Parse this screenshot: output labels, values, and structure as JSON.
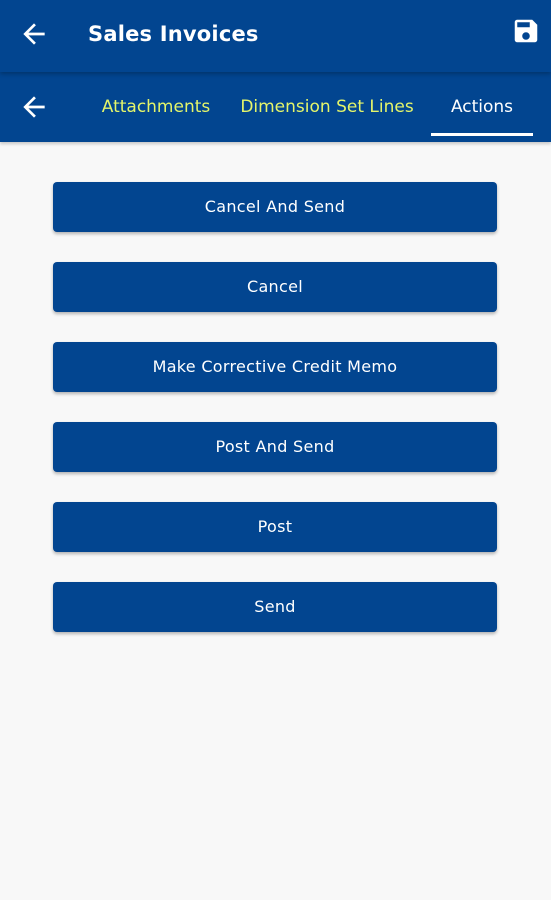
{
  "header": {
    "title": "Sales Invoices",
    "back_icon": "arrow-left-icon",
    "save_icon": "floppy-disk-icon"
  },
  "tabs": {
    "back_icon": "arrow-left-icon",
    "items": [
      {
        "label": "Attachments",
        "active": false
      },
      {
        "label": "Dimension Set Lines",
        "active": false
      },
      {
        "label": "Actions",
        "active": true
      }
    ]
  },
  "actions": {
    "buttons": [
      {
        "label": "Cancel And Send"
      },
      {
        "label": "Cancel"
      },
      {
        "label": "Make Corrective Credit Memo"
      },
      {
        "label": "Post And Send"
      },
      {
        "label": "Post"
      },
      {
        "label": "Send"
      }
    ]
  },
  "colors": {
    "primary": "#024590",
    "inactive_tab_text": "#e4f56a",
    "active_tab_text": "#ffffff",
    "background": "#f8f8f8"
  }
}
